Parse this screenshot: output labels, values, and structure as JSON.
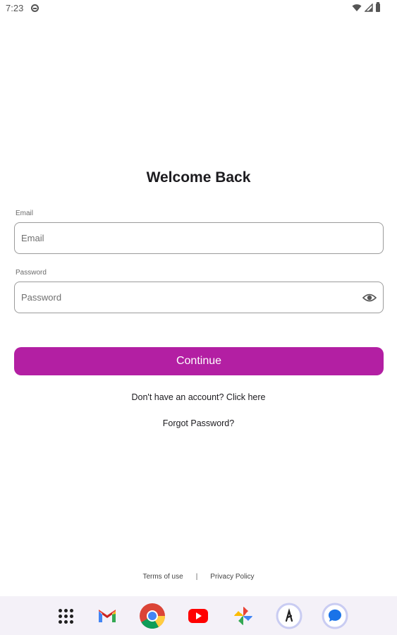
{
  "status_bar": {
    "time": "7:23",
    "app_icon": "android-head-icon",
    "right_icons": [
      "wifi-icon",
      "signal-icon",
      "battery-icon"
    ]
  },
  "login": {
    "title": "Welcome Back",
    "email": {
      "label": "Email",
      "placeholder": "Email",
      "value": ""
    },
    "password": {
      "label": "Password",
      "placeholder": "Password",
      "value": "",
      "toggle_icon": "eye-icon"
    },
    "continue_label": "Continue",
    "signup_text": "Don't have an account? Click here",
    "forgot_text": "Forgot Password?"
  },
  "footer": {
    "terms": "Terms of use",
    "separator": "|",
    "privacy": "Privacy Policy"
  },
  "dock": {
    "apps": [
      "apps-grid-icon",
      "gmail-icon",
      "chrome-icon",
      "youtube-icon",
      "photos-icon",
      "app-icon",
      "messages-icon"
    ]
  },
  "colors": {
    "accent": "#b31fa3",
    "background": "#ffffff",
    "dock_background": "#f4f1f8"
  }
}
